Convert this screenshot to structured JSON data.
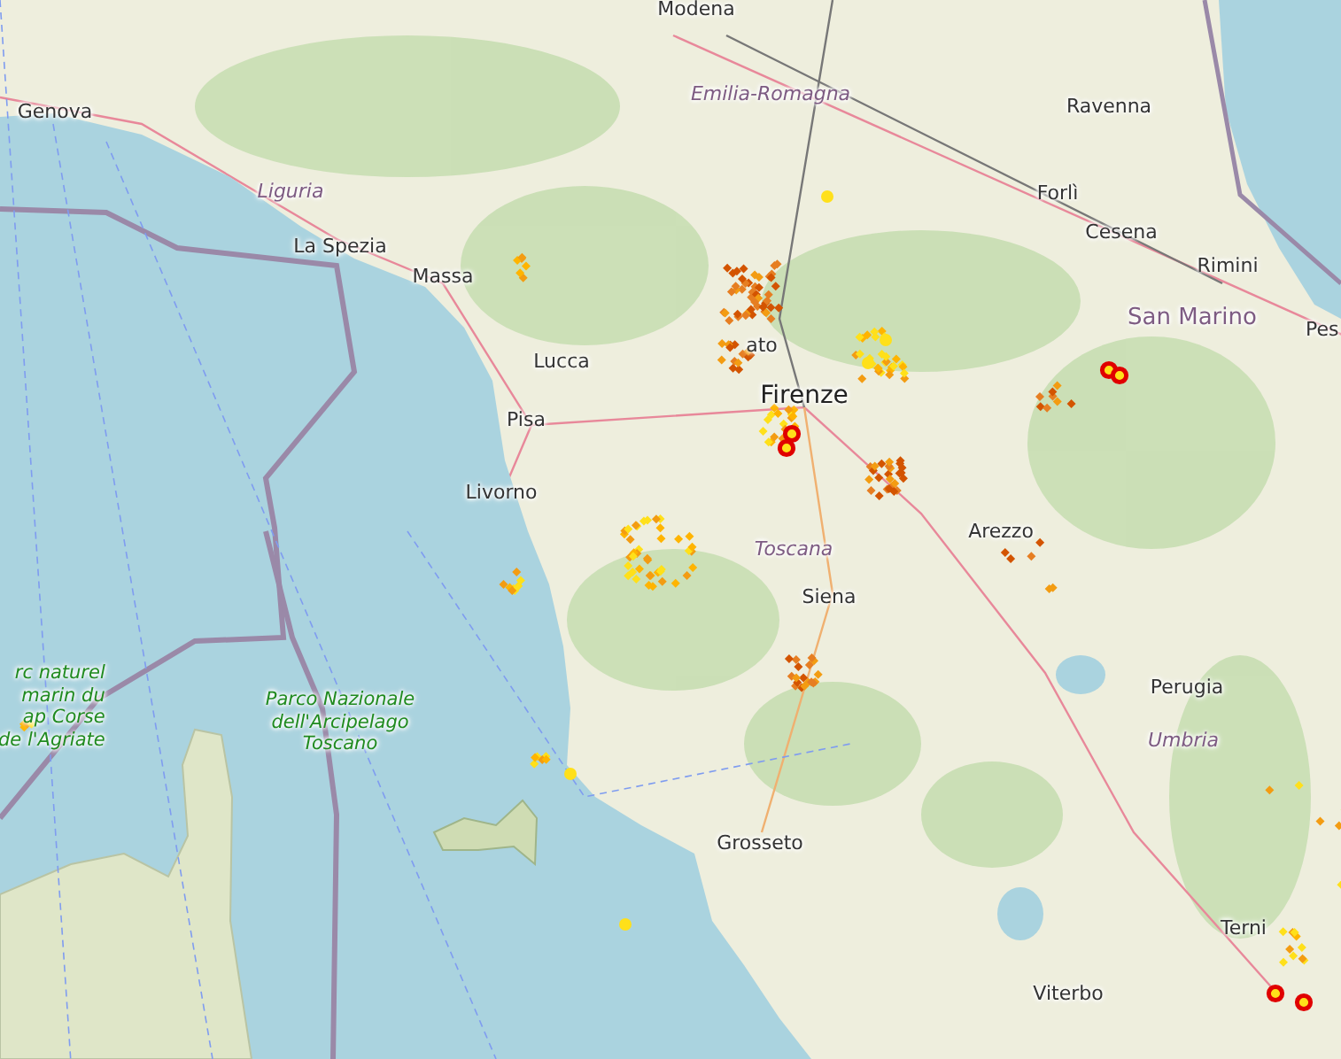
{
  "map": {
    "labels": [
      {
        "kind": "city",
        "text": "Modena"
      },
      {
        "kind": "city",
        "text": "Genova"
      },
      {
        "kind": "region",
        "text": "Emilia-Romagna"
      },
      {
        "kind": "city",
        "text": "Ravenna"
      },
      {
        "kind": "region",
        "text": "Liguria"
      },
      {
        "kind": "city",
        "text": "Forlì"
      },
      {
        "kind": "city",
        "text": "Cesena"
      },
      {
        "kind": "city",
        "text": "La Spezia"
      },
      {
        "kind": "city",
        "text": "Rimini"
      },
      {
        "kind": "city",
        "text": "Massa"
      },
      {
        "kind": "country",
        "text": "San Marino"
      },
      {
        "kind": "city",
        "text": "Pes"
      },
      {
        "kind": "city",
        "text": "Lucca"
      },
      {
        "kind": "city",
        "text": "ato"
      },
      {
        "kind": "capital",
        "text": "Firenze"
      },
      {
        "kind": "city",
        "text": "Pisa"
      },
      {
        "kind": "city",
        "text": "Livorno"
      },
      {
        "kind": "city",
        "text": "Arezzo"
      },
      {
        "kind": "region",
        "text": "Toscana"
      },
      {
        "kind": "city",
        "text": "Siena"
      },
      {
        "kind": "park",
        "lines": [
          "rc naturel",
          "marin du",
          "ap Corse",
          "de l'Agriate"
        ]
      },
      {
        "kind": "park",
        "lines": [
          "Parco Nazionale",
          "dell'Arcipelago",
          "Toscano"
        ]
      },
      {
        "kind": "city",
        "text": "Perugia"
      },
      {
        "kind": "region",
        "text": "Umbria"
      },
      {
        "kind": "city",
        "text": "Grosseto"
      },
      {
        "kind": "city",
        "text": "Terni"
      },
      {
        "kind": "city",
        "text": "Viterbo"
      }
    ]
  }
}
